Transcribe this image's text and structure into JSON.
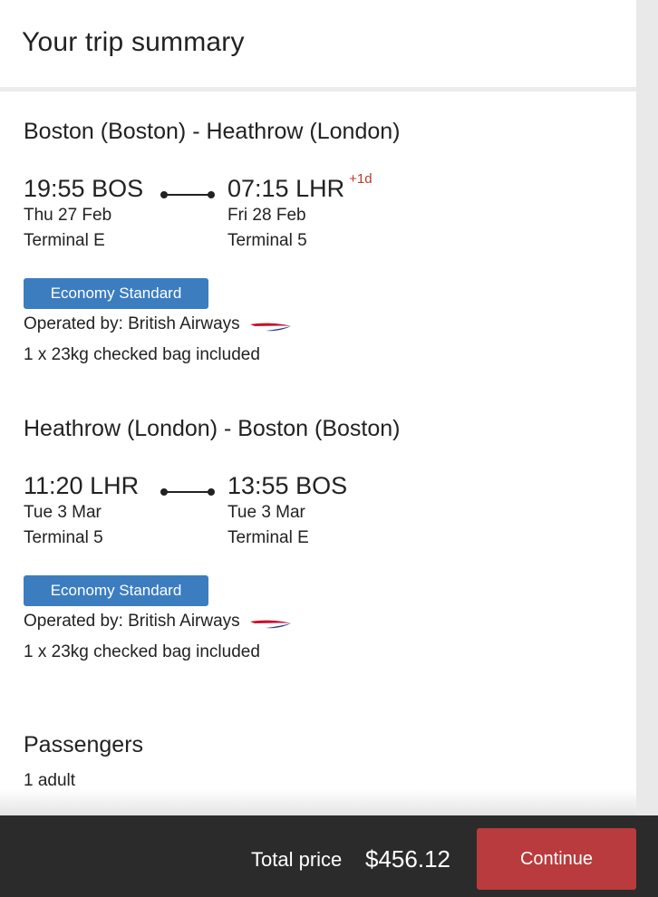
{
  "header": {
    "title": "Your trip summary"
  },
  "flights": [
    {
      "route": "Boston (Boston) - Heathrow (London)",
      "departure": {
        "time": "19:55 BOS",
        "date": "Thu 27 Feb",
        "terminal": "Terminal E"
      },
      "arrival": {
        "time": "07:15 LHR",
        "day_offset": "+1d",
        "date": "Fri 28 Feb",
        "terminal": "Terminal 5"
      },
      "cabin": "Economy Standard",
      "operated_by": "Operated by: British Airways",
      "baggage": "1 x 23kg checked bag included",
      "airline_logo_icon": "british-airways-speedmarque-icon"
    },
    {
      "route": "Heathrow (London) - Boston (Boston)",
      "departure": {
        "time": "11:20 LHR",
        "date": "Tue 3 Mar",
        "terminal": "Terminal 5"
      },
      "arrival": {
        "time": "13:55 BOS",
        "day_offset": "",
        "date": "Tue 3 Mar",
        "terminal": "Terminal E"
      },
      "cabin": "Economy Standard",
      "operated_by": "Operated by: British Airways",
      "baggage": "1 x 23kg checked bag included",
      "airline_logo_icon": "british-airways-speedmarque-icon"
    }
  ],
  "passengers": {
    "title": "Passengers",
    "count": "1 adult"
  },
  "footer": {
    "total_label": "Total price",
    "total_value": "$456.12",
    "continue_label": "Continue"
  },
  "colors": {
    "cabin_badge": "#3c7dc0",
    "continue_button": "#b93b3d",
    "footer_background": "#2b2b2b",
    "day_offset": "#c0392b"
  }
}
